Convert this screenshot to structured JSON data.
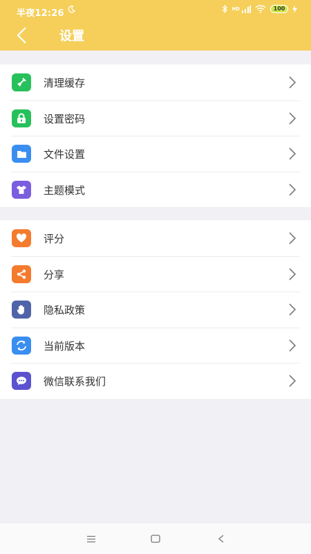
{
  "status_bar": {
    "time": "半夜12:26",
    "network": "HD",
    "battery": "100"
  },
  "header": {
    "title": "设置"
  },
  "groups": [
    {
      "items": [
        {
          "label": "清理缓存",
          "icon": "broom-icon",
          "color": "#27c15b"
        },
        {
          "label": "设置密码",
          "icon": "lock-icon",
          "color": "#27c15b"
        },
        {
          "label": "文件设置",
          "icon": "folder-icon",
          "color": "#3a8ef0"
        },
        {
          "label": "主题模式",
          "icon": "tshirt-icon",
          "color": "#7b5de0"
        }
      ]
    },
    {
      "items": [
        {
          "label": "评分",
          "icon": "heart-icon",
          "color": "#f47b2e"
        },
        {
          "label": "分享",
          "icon": "share-icon",
          "color": "#f47b2e"
        },
        {
          "label": "隐私政策",
          "icon": "hand-icon",
          "color": "#4f63a8"
        },
        {
          "label": "当前版本",
          "icon": "refresh-icon",
          "color": "#3a8ef0"
        },
        {
          "label": "微信联系我们",
          "icon": "chat-icon",
          "color": "#5b52cf"
        }
      ]
    }
  ],
  "colors": {
    "header": "#f5cf5a",
    "background": "#f1f0f5"
  }
}
